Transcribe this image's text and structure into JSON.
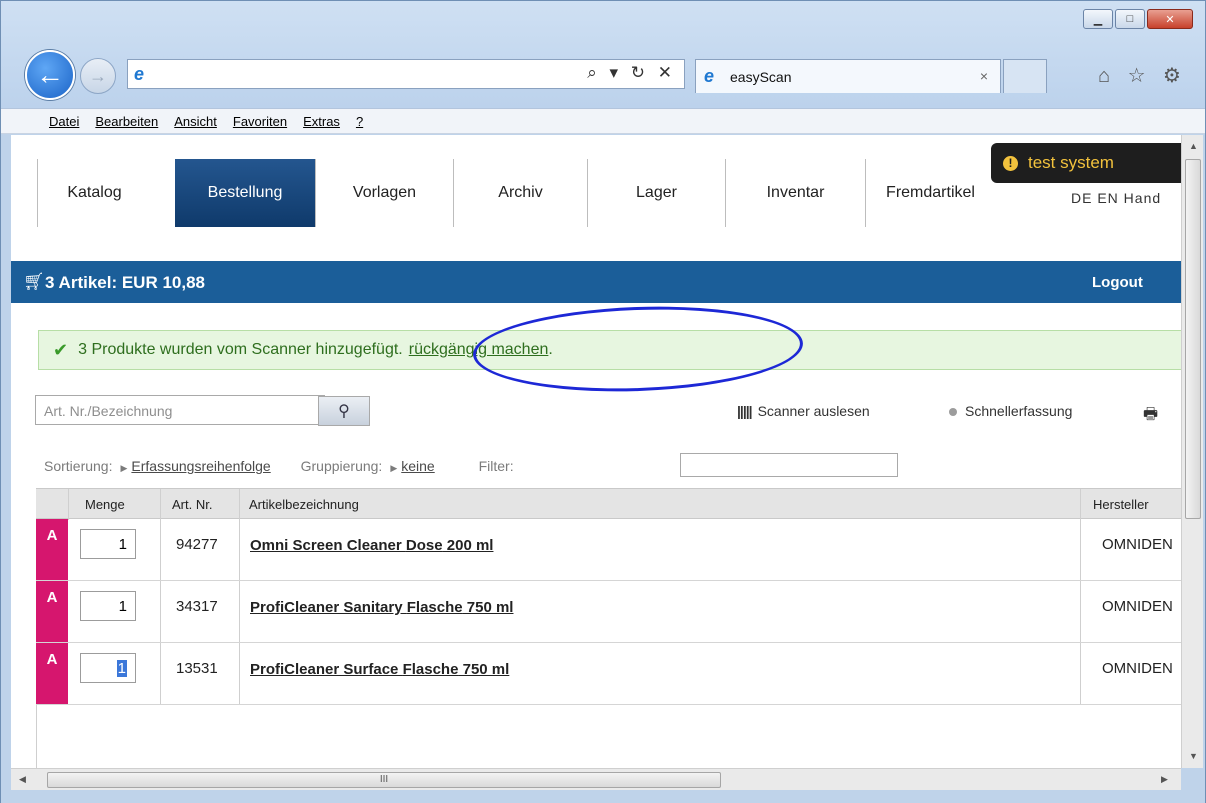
{
  "browser": {
    "tab_title": "easyScan",
    "tab_close": "×",
    "menu": [
      "Datei",
      "Bearbeiten",
      "Ansicht",
      "Favoriten",
      "Extras",
      "?"
    ],
    "address_tools": "⌕ ▾ ↻ ✕",
    "chrome_icons": "⌂ ☆ ⚙"
  },
  "nav": {
    "items": [
      "Katalog",
      "Bestellung",
      "Vorlagen",
      "Archiv",
      "Lager",
      "Inventar",
      "Fremdartikel"
    ],
    "active": "Bestellung",
    "test_badge": "test system",
    "languages": "DE  EN  Hand"
  },
  "cart": {
    "summary": "3 Artikel: EUR 10,88",
    "logout": "Logout"
  },
  "message": {
    "text": "3 Produkte wurden vom Scanner hinzugefügt.",
    "undo": "rückgängig machen",
    "suffix": "."
  },
  "search": {
    "placeholder": "Art. Nr./Bezeichnung"
  },
  "tools": {
    "scanner": "Scanner auslesen",
    "quick": "Schnellerfassung"
  },
  "sorting": {
    "sort_label": "Sortierung:",
    "sort_value": "Erfassungsreihenfolge",
    "group_label": "Gruppierung:",
    "group_value": "keine",
    "filter_label": "Filter:"
  },
  "table": {
    "headers": {
      "menge": "Menge",
      "artnr": "Art. Nr.",
      "bezeichnung": "Artikelbezeichnung",
      "hersteller": "Hersteller"
    },
    "rows": [
      {
        "badge": "A",
        "qty": "1",
        "artnr": "94277",
        "name_pre": "Omni Screen Cleaner ",
        "name_bold": "Dose",
        "name_post": " 200 ml",
        "maker": "OMNIDEN"
      },
      {
        "badge": "A",
        "qty": "1",
        "artnr": "34317",
        "name_pre": "ProfiCleaner Sanitary ",
        "name_bold": "Flasche",
        "name_post": " 750 ml",
        "maker": "OMNIDEN"
      },
      {
        "badge": "A",
        "qty": "1",
        "artnr": "13531",
        "name_pre": "ProfiCleaner Surface ",
        "name_bold": "Flasche",
        "name_post": " 750 ml",
        "maker": "OMNIDEN"
      }
    ]
  },
  "scrollbar": {
    "h_grip": "III"
  }
}
